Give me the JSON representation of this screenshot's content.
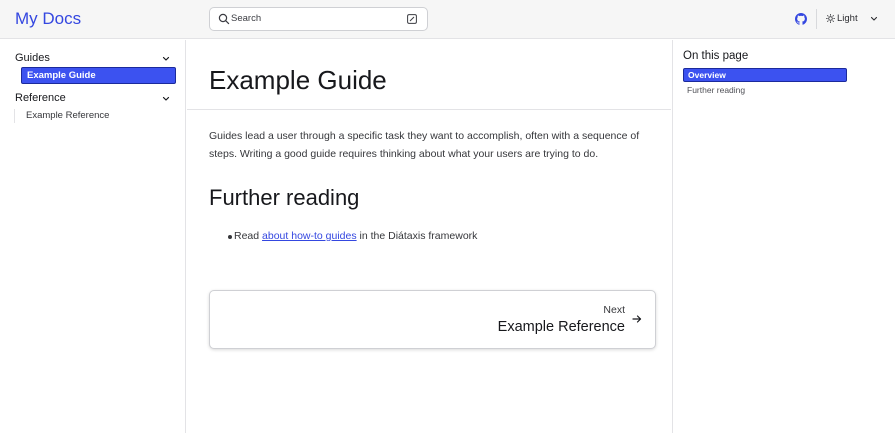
{
  "header": {
    "site_title": "My Docs",
    "search_placeholder": "Search",
    "theme_label": "Light",
    "icons": {
      "search": "search-icon",
      "search_shortcut": "keyboard-shortcut-icon",
      "github": "github-icon",
      "theme": "sun-icon",
      "theme_caret": "chevron-down-icon"
    }
  },
  "sidebar": {
    "groups": [
      {
        "label": "Guides",
        "items": [
          {
            "label": "Example Guide",
            "active": true
          }
        ]
      },
      {
        "label": "Reference",
        "items": [
          {
            "label": "Example Reference",
            "active": false
          }
        ]
      }
    ]
  },
  "main": {
    "title": "Example Guide",
    "intro": "Guides lead a user through a specific task they want to accomplish, often with a sequence of steps. Writing a good guide requires thinking about what your users are trying to do.",
    "section_heading": "Further reading",
    "bullet": {
      "prefix": "Read ",
      "link_text": "about how-to guides",
      "suffix": " in the Diátaxis framework"
    },
    "next": {
      "label": "Next",
      "title": "Example Reference"
    }
  },
  "toc": {
    "heading": "On this page",
    "items": [
      {
        "label": "Overview",
        "active": true
      },
      {
        "label": "Further reading",
        "active": false
      }
    ]
  },
  "colors": {
    "accent": "#3c52f0",
    "link": "#3447e0",
    "header_bg": "#f6f6f6"
  }
}
